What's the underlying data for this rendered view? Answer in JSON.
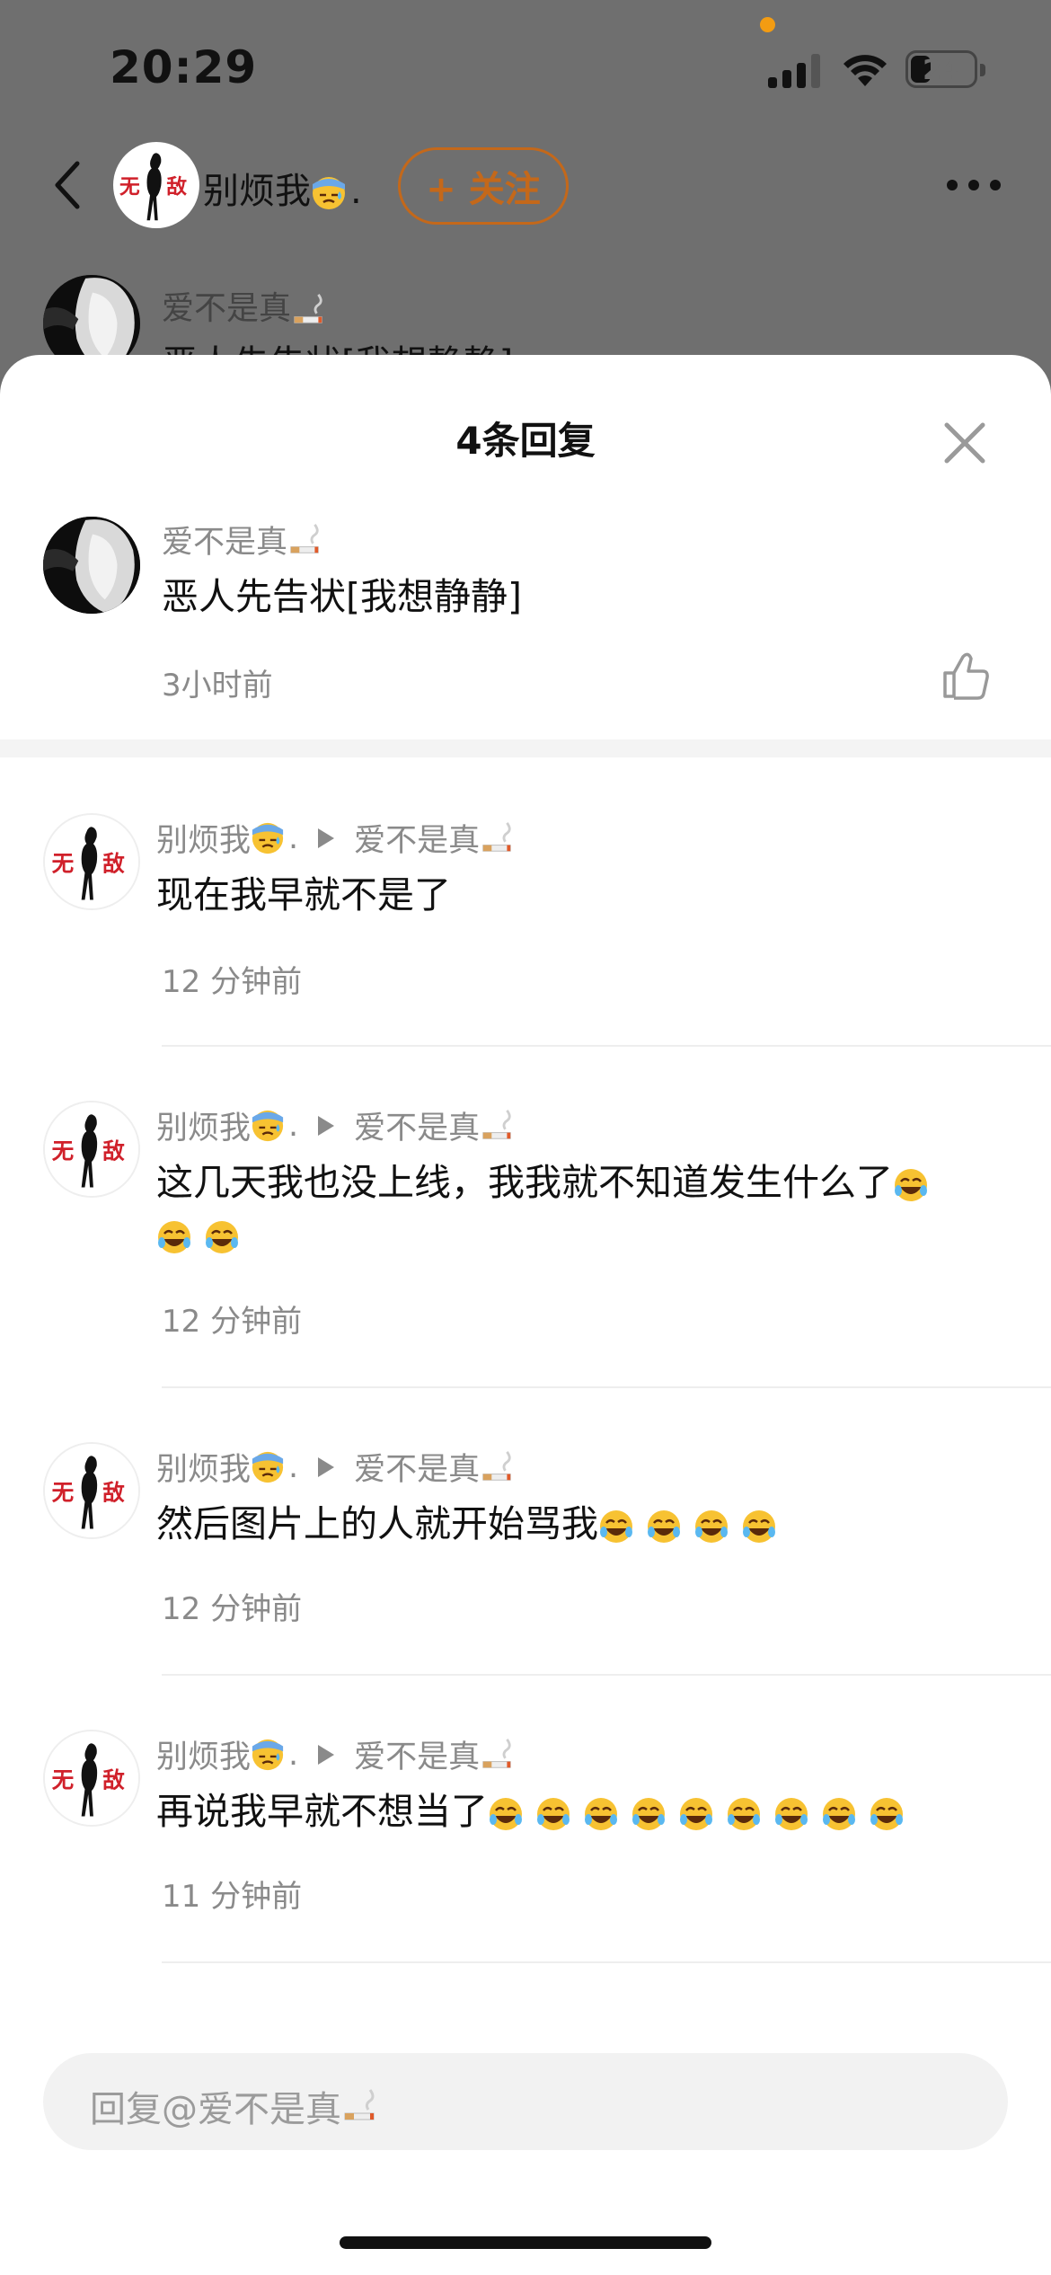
{
  "status_bar": {
    "time": "20:29",
    "battery": "24"
  },
  "header": {
    "author_name": "别烦我",
    "author_suffix": ".",
    "follow_label": "+ 关注"
  },
  "background_comment": {
    "user": "爱不是真",
    "text": "恶人先告状[我想静静]"
  },
  "sheet": {
    "title": "4条回复",
    "parent": {
      "user": "爱不是真",
      "text": "恶人先告状[我想静静]",
      "time": "3小时前"
    },
    "replies": [
      {
        "from": "别烦我",
        "from_suffix": ".",
        "to": "爱不是真",
        "text": "现在我早就不是了",
        "time": "12 分钟前"
      },
      {
        "from": "别烦我",
        "from_suffix": ".",
        "to": "爱不是真",
        "text": "这几天我也没上线，我我就不知道发生什么了",
        "time": "12 分钟前",
        "laugh_emoji_count": 3
      },
      {
        "from": "别烦我",
        "from_suffix": ".",
        "to": "爱不是真",
        "text": "然后图片上的人就开始骂我",
        "time": "12 分钟前",
        "laugh_emoji_count": 4
      },
      {
        "from": "别烦我",
        "from_suffix": ".",
        "to": "爱不是真",
        "text": "再说我早就不想当了",
        "time": "11 分钟前",
        "laugh_emoji_count": 9
      }
    ],
    "reply_input": {
      "placeholder": "回复@爱不是真"
    }
  },
  "colors": {
    "accent_orange": "#c4681a",
    "secondary_text": "#8a8a8a",
    "dim_overlay": "#6f6f6f"
  },
  "icons": [
    "back-icon",
    "more-icon",
    "close-icon",
    "like-icon",
    "laugh-emoji-icon",
    "sweat-emoji-icon",
    "cigarette-emoji-icon"
  ]
}
